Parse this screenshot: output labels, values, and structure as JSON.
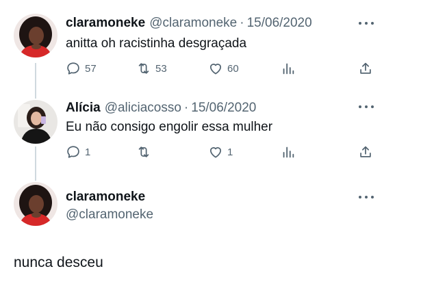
{
  "tweets": [
    {
      "display_name": "claramoneke",
      "handle": "@claramoneke",
      "separator": "·",
      "date": "15/06/2020",
      "text": "anitta oh racistinha desgraçada",
      "replies": "57",
      "retweets": "53",
      "likes": "60"
    },
    {
      "display_name": "Alícia",
      "handle": "@aliciacosso",
      "separator": "·",
      "date": "15/06/2020",
      "text": "Eu não consigo engolir essa mulher",
      "replies": "1",
      "retweets": "",
      "likes": "1"
    }
  ],
  "focused": {
    "display_name": "claramoneke",
    "handle": "@claramoneke",
    "text": "nunca desceu"
  },
  "colors": {
    "text_primary": "#0f1419",
    "text_secondary": "#536471",
    "thread_line": "#cfd9de",
    "avatar_red": "#d62828"
  },
  "icons": [
    "more-icon",
    "reply-icon",
    "retweet-icon",
    "like-icon",
    "views-icon",
    "share-icon"
  ]
}
